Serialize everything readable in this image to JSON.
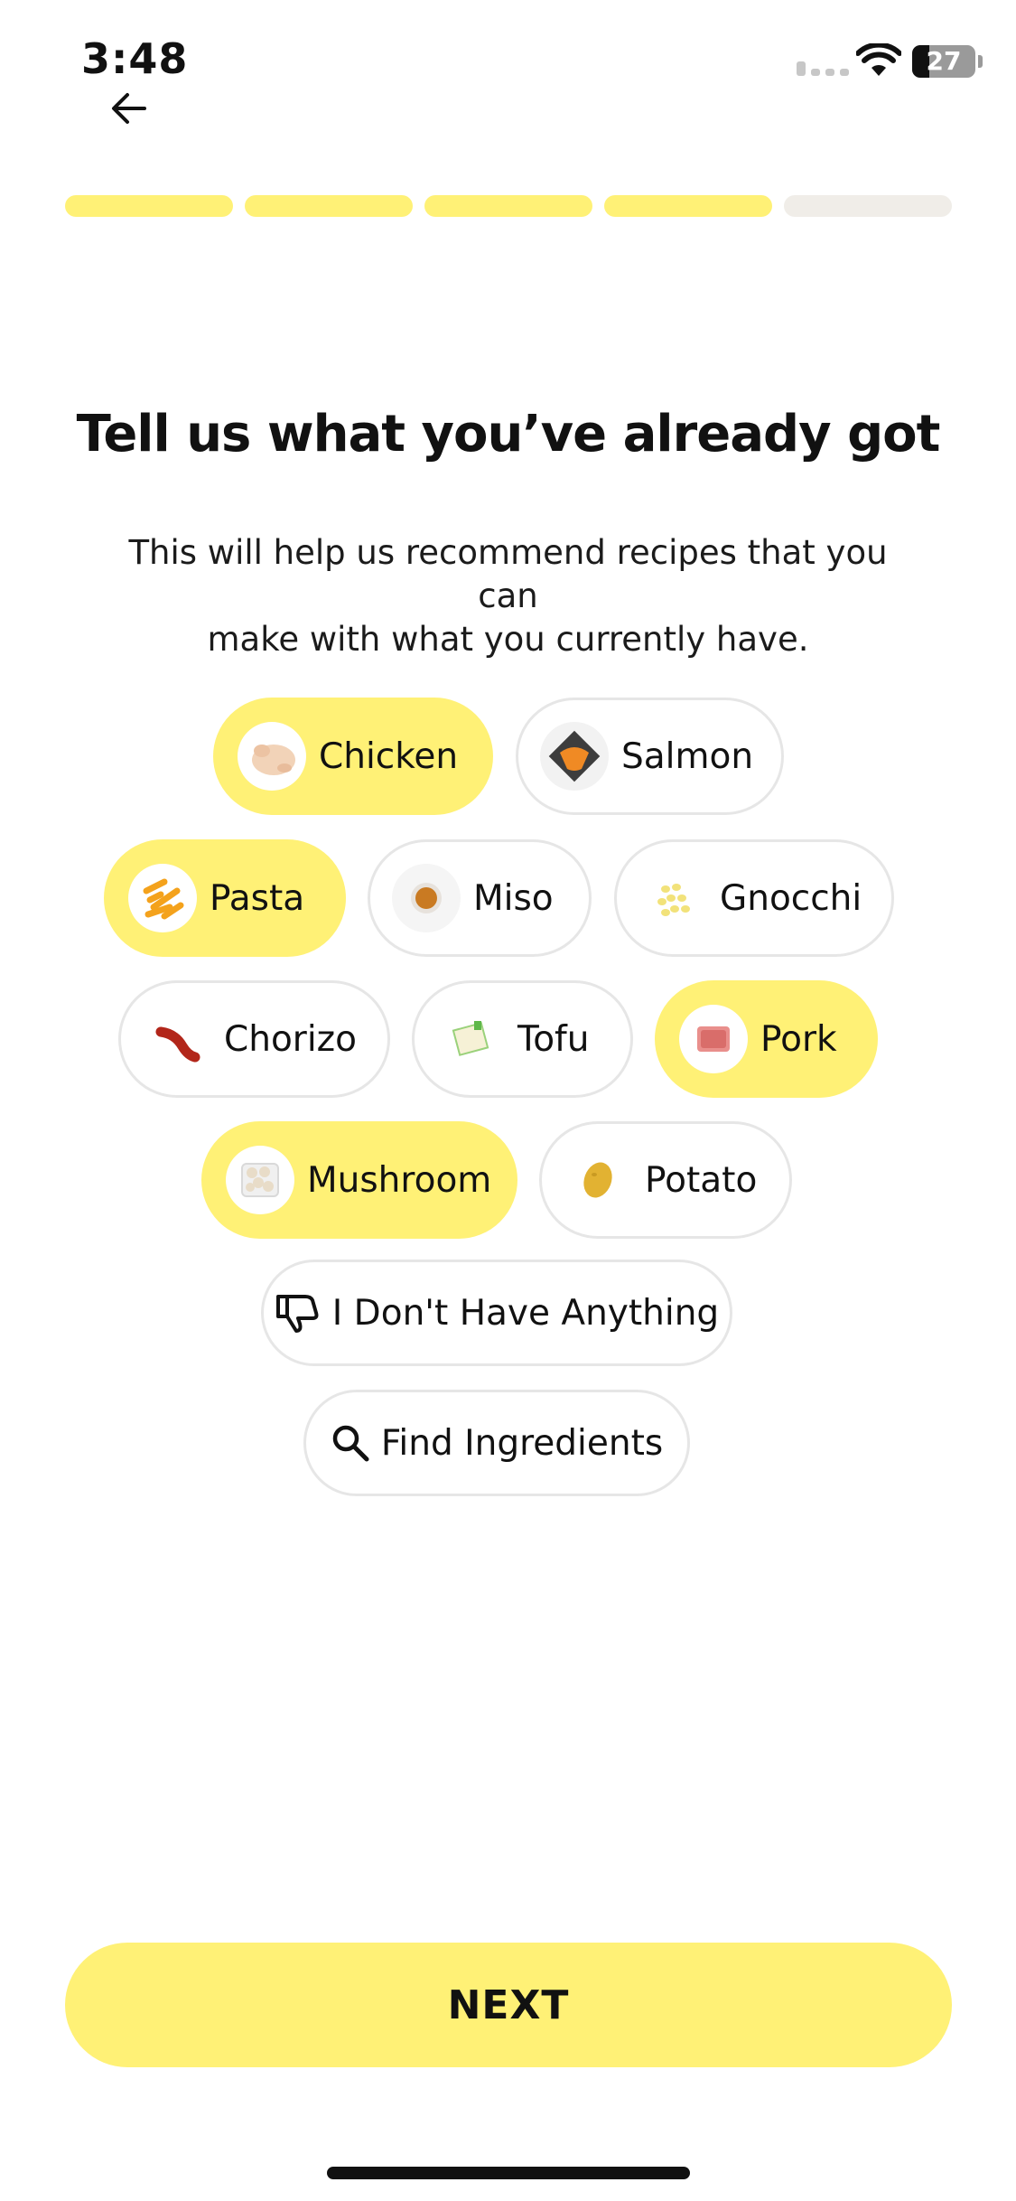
{
  "status_bar": {
    "time": "3:48",
    "battery_level": "27",
    "battery_percent": 27
  },
  "navigation": {
    "back_icon": "arrow-left-icon"
  },
  "progress": {
    "total_steps": 5,
    "completed_steps": 4,
    "active_color": "#fff176",
    "inactive_color": "#f0ede8"
  },
  "header": {
    "title": "Tell us what you’ve already got",
    "subtitle_line1": "This will help us recommend recipes that you can",
    "subtitle_line2": "make with what you currently have."
  },
  "ingredients": [
    {
      "label": "Chicken",
      "selected": true,
      "icon": "chicken-icon"
    },
    {
      "label": "Salmon",
      "selected": false,
      "icon": "salmon-icon"
    },
    {
      "label": "Pasta",
      "selected": true,
      "icon": "pasta-icon"
    },
    {
      "label": "Miso",
      "selected": false,
      "icon": "miso-icon"
    },
    {
      "label": "Gnocchi",
      "selected": false,
      "icon": "gnocchi-icon"
    },
    {
      "label": "Chorizo",
      "selected": false,
      "icon": "chorizo-icon"
    },
    {
      "label": "Tofu",
      "selected": false,
      "icon": "tofu-icon"
    },
    {
      "label": "Pork",
      "selected": true,
      "icon": "pork-icon"
    },
    {
      "label": "Mushroom",
      "selected": true,
      "icon": "mushroom-icon"
    },
    {
      "label": "Potato",
      "selected": false,
      "icon": "potato-icon"
    }
  ],
  "actions": {
    "nothing_label": "I Don't Have Anything",
    "nothing_icon": "thumbs-down-icon",
    "find_label": "Find Ingredients",
    "find_icon": "search-icon"
  },
  "footer": {
    "next_label": "NEXT"
  },
  "colors": {
    "accent": "#fff176",
    "chip_border": "#e6e6e6",
    "text": "#111111"
  }
}
